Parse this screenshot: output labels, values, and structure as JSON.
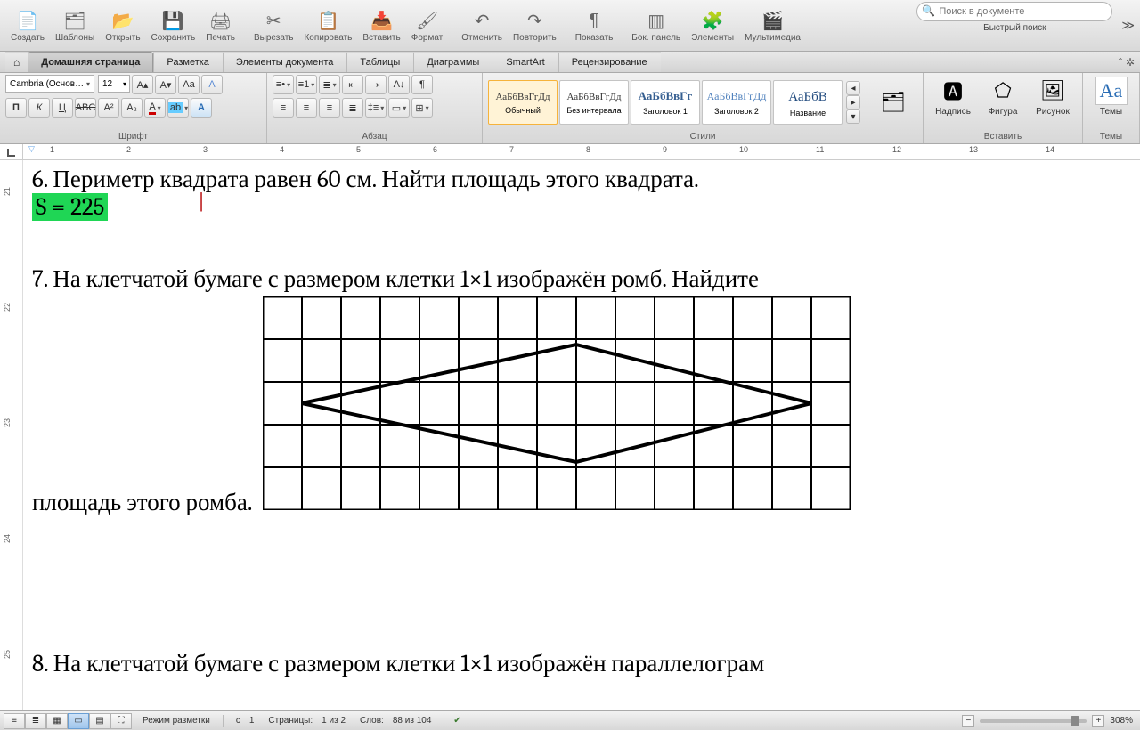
{
  "toolbar": {
    "items": [
      {
        "label": "Создать",
        "icon": "📄"
      },
      {
        "label": "Шаблоны",
        "icon": "🗂"
      },
      {
        "label": "Открыть",
        "icon": "📂"
      },
      {
        "label": "Сохранить",
        "icon": "💾"
      },
      {
        "label": "Печать",
        "icon": "🖨"
      },
      {
        "label": "Вырезать",
        "icon": "✂"
      },
      {
        "label": "Копировать",
        "icon": "📋"
      },
      {
        "label": "Вставить",
        "icon": "📥"
      },
      {
        "label": "Формат",
        "icon": "🖌"
      },
      {
        "label": "Отменить",
        "icon": "↶"
      },
      {
        "label": "Повторить",
        "icon": "↷"
      },
      {
        "label": "Показать",
        "icon": "¶"
      },
      {
        "label": "Бок. панель",
        "icon": "▥"
      },
      {
        "label": "Элементы",
        "icon": "🧩"
      },
      {
        "label": "Мультимедиа",
        "icon": "🎬"
      }
    ],
    "separators_after": [
      4,
      8,
      10,
      11
    ],
    "search_placeholder": "Поиск в документе",
    "quick_search_label": "Быстрый поиск"
  },
  "ribbon_tabs": [
    "Домашняя страница",
    "Разметка",
    "Элементы документа",
    "Таблицы",
    "Диаграммы",
    "SmartArt",
    "Рецензирование"
  ],
  "ribbon_active_tab": 0,
  "ribbon": {
    "panels": {
      "font": "Шрифт",
      "paragraph": "Абзац",
      "styles": "Стили",
      "insert": "Вставить",
      "themes": "Темы"
    },
    "font_name": "Cambria (Основ…",
    "font_size": "12",
    "style_cards": [
      {
        "sample": "АаБбВвГгДд",
        "label": "Обычный",
        "sel": true,
        "cls": ""
      },
      {
        "sample": "АаБбВвГгДд",
        "label": "Без интервала",
        "sel": false,
        "cls": ""
      },
      {
        "sample": "АаБбВвГг",
        "label": "Заголовок 1",
        "sel": false,
        "cls": "h1"
      },
      {
        "sample": "АаБбВвГгДд",
        "label": "Заголовок 2",
        "sel": false,
        "cls": "h2"
      },
      {
        "sample": "АаБбВ",
        "label": "Название",
        "sel": false,
        "cls": "title"
      }
    ],
    "insert_items": [
      {
        "label": "Надпись",
        "icon": "🅰"
      },
      {
        "label": "Фигура",
        "icon": "⬠"
      },
      {
        "label": "Рисунок",
        "icon": "🖼"
      }
    ],
    "themes_label": "Темы",
    "themes_icon": "Aa"
  },
  "ruler": {
    "numbers": [
      1,
      2,
      3,
      4,
      5,
      6,
      7,
      8,
      9,
      10,
      11,
      12,
      13,
      14
    ]
  },
  "vruler": {
    "numbers": [
      "21",
      "22",
      "23",
      "24",
      "25"
    ]
  },
  "document": {
    "p6": "6. Периметр квадрата равен 60 см. Найти площадь этого квадрата.",
    "answer": "S = 225",
    "p7_a": "7.  На клетчатой бумаге с размером клетки 1×1 изображён ромб. Найдите",
    "p7_b": "площадь этого ромба.",
    "p8": "8.  На клетчатой бумаге с размером клетки 1×1 изображён параллелограм"
  },
  "status": {
    "mode": "Режим разметки",
    "col_label": "с",
    "col": "1",
    "pages_label": "Страницы:",
    "pages": "1 из 2",
    "words_label": "Слов:",
    "words": "88 из 104",
    "zoom": "308%"
  }
}
